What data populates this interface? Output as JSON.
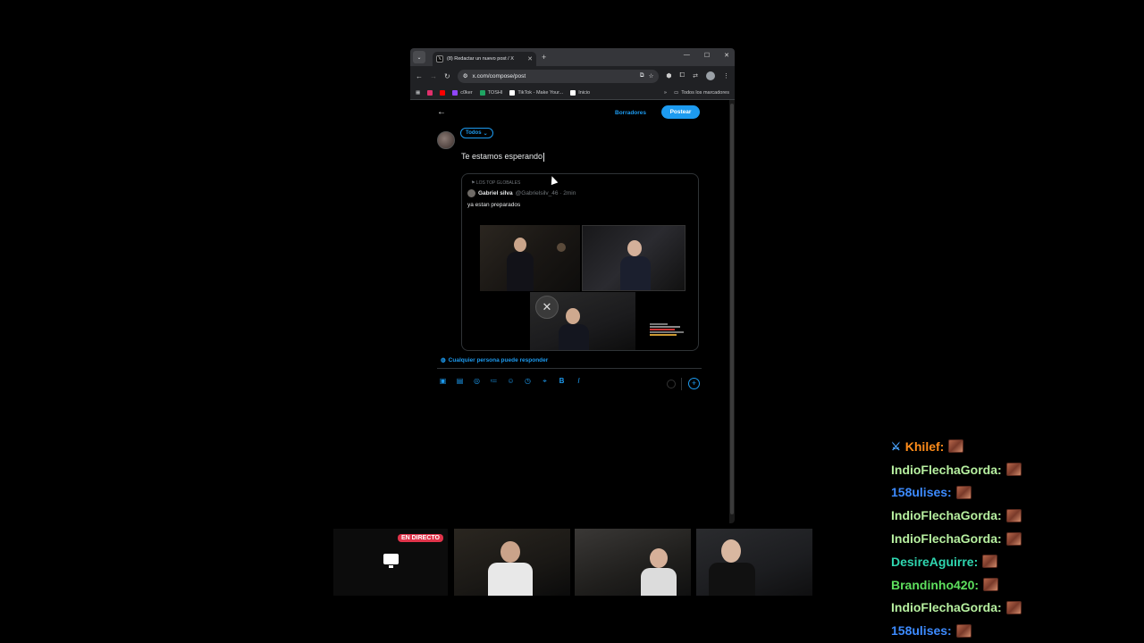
{
  "browser": {
    "tab_title": "(8) Redactar un nuevo post / X",
    "url": "x.com/compose/post",
    "bookmarks": [
      {
        "label": "",
        "color": "#e1306c",
        "icon": "instagram-icon"
      },
      {
        "label": "",
        "color": "#ff0000",
        "icon": "youtube-icon"
      },
      {
        "label": "c0ker",
        "color": "#9146ff",
        "icon": "twitch-icon"
      },
      {
        "label": "TOSHI",
        "color": "#1fa463",
        "icon": "sheets-icon"
      },
      {
        "label": "TikTok - Make Your...",
        "color": "#ffffff",
        "icon": "tiktok-icon"
      },
      {
        "label": "Inicio",
        "color": "#ffffff",
        "icon": "x-icon"
      }
    ],
    "bookmarks_overflow": "»",
    "all_bookmarks": "Todos los marcadores"
  },
  "compose": {
    "drafts_label": "Borradores",
    "post_label": "Postear",
    "audience_label": "Todos",
    "text": "Te estamos esperando",
    "reply_setting": "Cualquier persona puede responder"
  },
  "quote": {
    "community": "LOS TOP GLOBALES",
    "name": "Gabriel silva",
    "meta": "@Gabrielsilv_46 · 2min",
    "text": "ya estan preparados"
  },
  "stream": {
    "live_label": "EN DIRECTO"
  },
  "chat": [
    {
      "user": "Khilef:",
      "color": "#ff8c1a",
      "badge": true
    },
    {
      "user": "IndioFlechaGorda:",
      "color": "#b7f0a0",
      "badge": false
    },
    {
      "user": "158ulises:",
      "color": "#3d8bff",
      "badge": false
    },
    {
      "user": "IndioFlechaGorda:",
      "color": "#b7f0a0",
      "badge": false
    },
    {
      "user": "IndioFlechaGorda:",
      "color": "#b7f0a0",
      "badge": false
    },
    {
      "user": "DesireAguirre:",
      "color": "#2fd6b0",
      "badge": false
    },
    {
      "user": "Brandinho420:",
      "color": "#5ee05e",
      "badge": false
    },
    {
      "user": "IndioFlechaGorda:",
      "color": "#b7f0a0",
      "badge": false
    },
    {
      "user": "158ulises:",
      "color": "#3d8bff",
      "badge": false
    }
  ]
}
